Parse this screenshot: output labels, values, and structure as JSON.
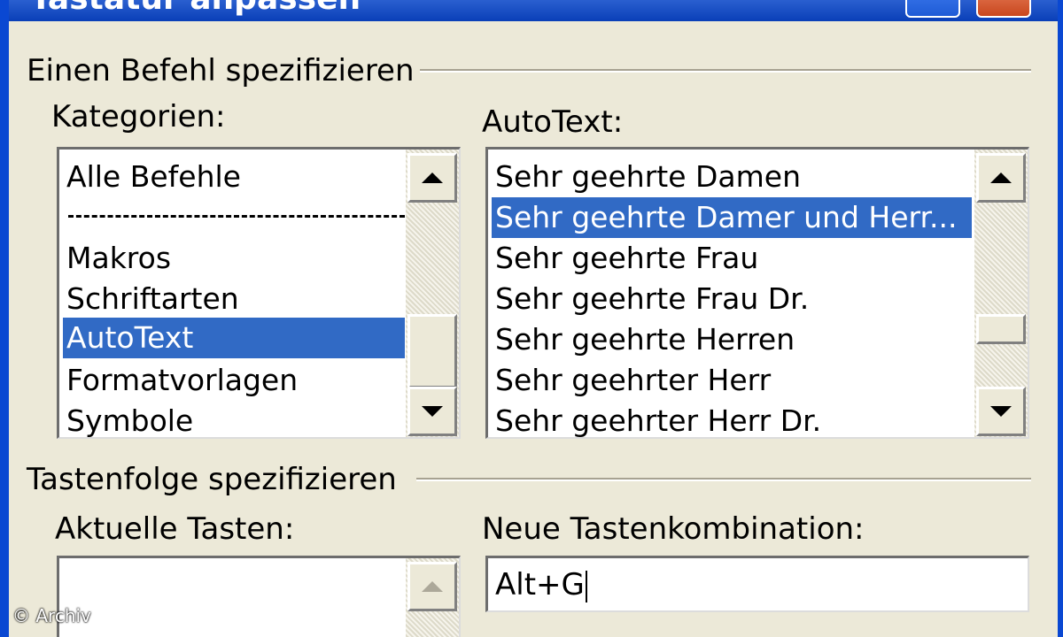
{
  "window": {
    "title": "Tastatur anpassen"
  },
  "command_group": {
    "title": "Einen Befehl spezifizieren"
  },
  "categories": {
    "label": "Kategorien:",
    "items": [
      "Alle Befehle",
      "Makros",
      "Schriftarten",
      "AutoText",
      "Formatvorlagen",
      "Symbole"
    ],
    "selected": "AutoText"
  },
  "autotext": {
    "label": "AutoText:",
    "items": [
      "Sehr geehrte Damen",
      "Sehr geehrte Damer und Herr...",
      "Sehr geehrte Frau",
      "Sehr geehrte Frau Dr.",
      "Sehr geehrte Herren",
      "Sehr geehrter Herr",
      "Sehr geehrter Herr Dr."
    ],
    "selected": "Sehr geehrte Damer und Herr..."
  },
  "keys_group": {
    "title": "Tastenfolge spezifizieren"
  },
  "current_keys": {
    "label": "Aktuelle Tasten:"
  },
  "new_shortcut": {
    "label": "Neue Tastenkombination:",
    "value": "Alt+G"
  },
  "watermark": "© Archiv",
  "colors": {
    "selection": "#316ac5",
    "dialog_bg": "#ece9d8",
    "titlebar": "#0a3fb8"
  }
}
